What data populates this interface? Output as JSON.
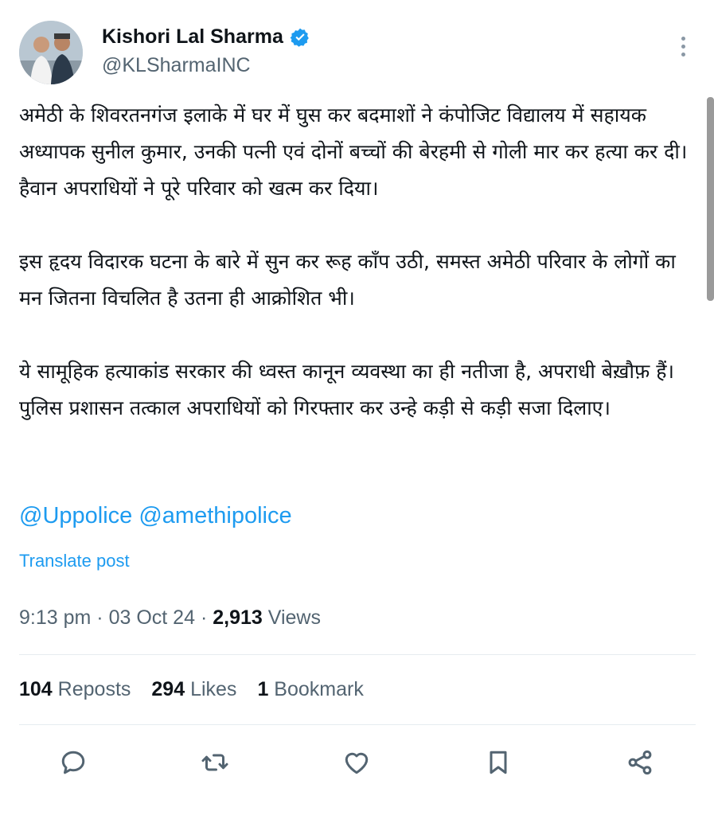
{
  "author": {
    "display_name": "Kishori Lal Sharma",
    "handle": "@KLSharmaINC",
    "verified_icon": "verified-badge-icon",
    "avatar": "avatar-photo"
  },
  "post": {
    "paragraphs": [
      "अमेठी के शिवरतनगंज इलाके में घर में घुस कर बदमाशों ने कंपोजिट विद्यालय में सहायक अध्यापक सुनील कुमार, उनकी पत्नी एवं दोनों बच्चों की बेरहमी से गोली मार कर हत्या कर दी। हैवान अपराधियों ने पूरे परिवार को खत्म कर दिया।",
      "इस हृदय विदारक घटना के बारे में सुन कर रूह काँप उठी, समस्त अमेठी परिवार के लोगों का मन जितना विचलित है उतना ही आक्रोशित भी।",
      "ये सामूहिक हत्याकांड सरकार की ध्वस्त कानून व्यवस्था का ही नतीजा है, अपराधी बेख़ौफ़ हैं। पुलिस प्रशासन तत्काल अपराधियों को गिरफ्तार कर उन्हे कड़ी से कड़ी सजा दिलाए।"
    ],
    "mentions": [
      "@Uppolice",
      "@amethipolice"
    ],
    "translate_label": "Translate post"
  },
  "meta": {
    "time": "9:13 pm",
    "separator": "·",
    "date": "03 Oct 24",
    "views_count": "2,913",
    "views_label": "Views"
  },
  "stats": {
    "reposts_count": "104",
    "reposts_label": "Reposts",
    "likes_count": "294",
    "likes_label": "Likes",
    "bookmarks_count": "1",
    "bookmarks_label": "Bookmark"
  },
  "actions": [
    "reply-icon",
    "repost-icon",
    "like-icon",
    "bookmark-icon",
    "share-icon"
  ],
  "colors": {
    "link": "#1d9bf0",
    "text_primary": "#0f1419",
    "text_secondary": "#536471",
    "icon": "#536471",
    "divider": "#e6ecf0"
  }
}
